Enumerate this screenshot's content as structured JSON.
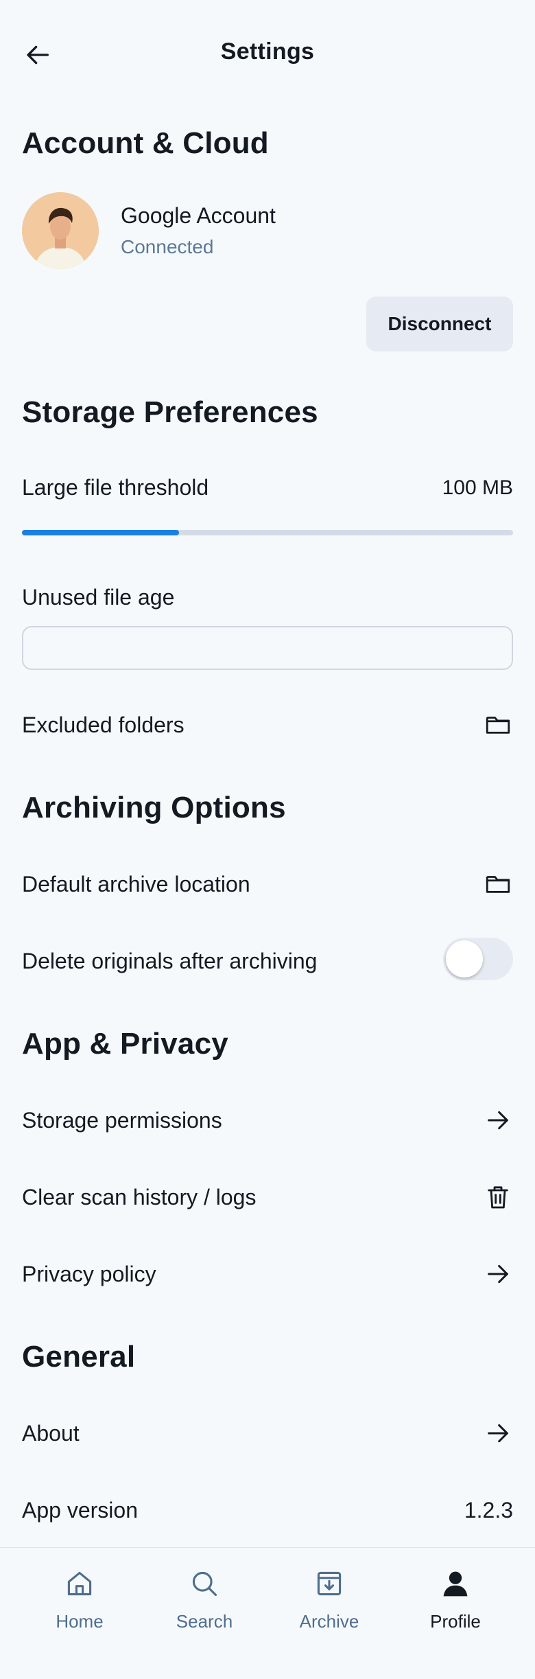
{
  "header": {
    "title": "Settings",
    "back_icon": "arrow-left-icon"
  },
  "account": {
    "section_title": "Account & Cloud",
    "provider": "Google Account",
    "status": "Connected",
    "disconnect_label": "Disconnect"
  },
  "storage": {
    "section_title": "Storage Preferences",
    "threshold_label": "Large file threshold",
    "threshold_value": "100 MB",
    "threshold_fraction": 0.32,
    "unused_age_label": "Unused file age",
    "unused_age_value": "",
    "excluded_label": "Excluded folders",
    "excluded_icon": "folder-icon"
  },
  "archiving": {
    "section_title": "Archiving Options",
    "location_label": "Default archive location",
    "location_icon": "folder-icon",
    "delete_label": "Delete originals after archiving",
    "delete_enabled": false
  },
  "privacy": {
    "section_title": "App & Privacy",
    "permissions_label": "Storage permissions",
    "clear_label": "Clear scan history / logs",
    "policy_label": "Privacy policy"
  },
  "general": {
    "section_title": "General",
    "about_label": "About",
    "version_label": "App version",
    "version_value": "1.2.3"
  },
  "nav": {
    "items": [
      {
        "label": "Home",
        "icon": "home-icon",
        "active": false
      },
      {
        "label": "Search",
        "icon": "search-icon",
        "active": false
      },
      {
        "label": "Archive",
        "icon": "archive-icon",
        "active": false
      },
      {
        "label": "Profile",
        "icon": "profile-icon",
        "active": true
      }
    ]
  },
  "colors": {
    "accent": "#1b7fe3",
    "muted_text": "#5a7896",
    "background": "#f6f9fc"
  }
}
